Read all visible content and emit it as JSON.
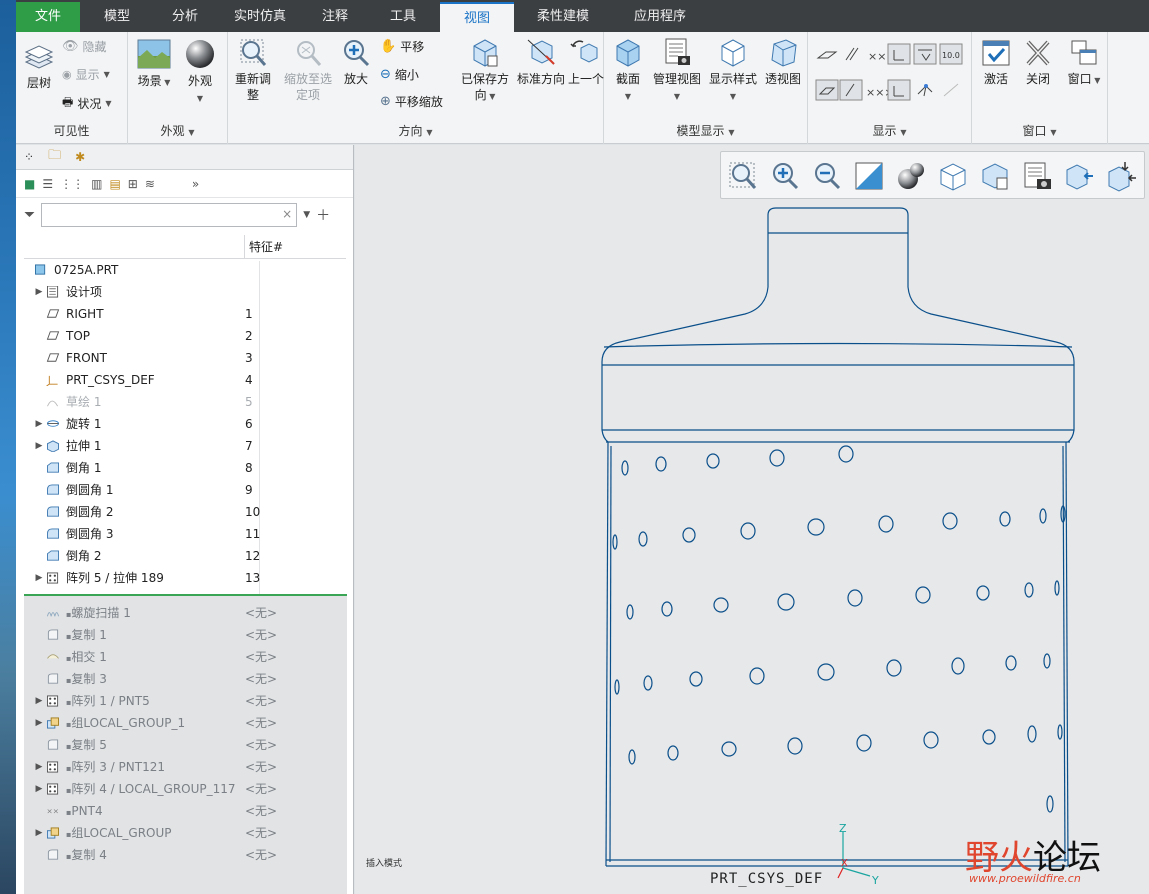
{
  "tabs": [
    {
      "label": "文件",
      "kind": "file"
    },
    {
      "label": "模型"
    },
    {
      "label": "分析"
    },
    {
      "label": "实时仿真"
    },
    {
      "label": "注释"
    },
    {
      "label": "工具"
    },
    {
      "label": "视图",
      "kind": "active"
    },
    {
      "label": "柔性建模"
    },
    {
      "label": "应用程序"
    }
  ],
  "ribbon": {
    "visibility": {
      "label": "可见性",
      "layer_tree": "层树",
      "hide": "隐藏",
      "show": "显示",
      "status": "状况"
    },
    "appearance": {
      "label": "外观",
      "scene": "场景",
      "appearance": "外观"
    },
    "orientation": {
      "label": "方向",
      "refit_1": "重新调",
      "refit_2": "整",
      "zoom_sel_1": "缩放至选",
      "zoom_sel_2": "定项",
      "zoom_in": "放大",
      "pan": "平移",
      "zoom_out": "缩小",
      "pan_zoom": "平移缩放",
      "saved_1": "已保存方",
      "saved_2": "向",
      "std_orient": "标准方向",
      "previous": "上一个"
    },
    "model_display": {
      "label": "模型显示",
      "section": "截面",
      "manage_views": "管理视图",
      "display_style": "显示样式",
      "perspective": "透视图"
    },
    "display": {
      "label": "显示"
    },
    "window": {
      "label": "窗口",
      "activate": "激活",
      "close": "关闭",
      "windows": "窗口"
    }
  },
  "model_tree": {
    "filter_placeholder": "",
    "column_feature": "特征#",
    "rows": [
      {
        "label": "0725A.PRT",
        "num": "",
        "icon": "part",
        "indent": 0,
        "exp": false
      },
      {
        "label": "设计项",
        "num": "",
        "icon": "design-items",
        "indent": 1,
        "exp": true
      },
      {
        "label": "RIGHT",
        "num": "1",
        "icon": "datum-plane",
        "indent": 1,
        "exp": false
      },
      {
        "label": "TOP",
        "num": "2",
        "icon": "datum-plane",
        "indent": 1,
        "exp": false
      },
      {
        "label": "FRONT",
        "num": "3",
        "icon": "datum-plane",
        "indent": 1,
        "exp": false
      },
      {
        "label": "PRT_CSYS_DEF",
        "num": "4",
        "icon": "csys",
        "indent": 1,
        "exp": false
      },
      {
        "label": "草绘 1",
        "num": "5",
        "icon": "sketch",
        "indent": 1,
        "exp": false,
        "dim": true
      },
      {
        "label": "旋转 1",
        "num": "6",
        "icon": "revolve",
        "indent": 1,
        "exp": true
      },
      {
        "label": "拉伸 1",
        "num": "7",
        "icon": "extrude",
        "indent": 1,
        "exp": true
      },
      {
        "label": "倒角 1",
        "num": "8",
        "icon": "chamfer",
        "indent": 1,
        "exp": false
      },
      {
        "label": "倒圆角 1",
        "num": "9",
        "icon": "round",
        "indent": 1,
        "exp": false
      },
      {
        "label": "倒圆角 2",
        "num": "10",
        "icon": "round",
        "indent": 1,
        "exp": false
      },
      {
        "label": "倒圆角 3",
        "num": "11",
        "icon": "round",
        "indent": 1,
        "exp": false
      },
      {
        "label": "倒角 2",
        "num": "12",
        "icon": "chamfer",
        "indent": 1,
        "exp": false
      },
      {
        "label": "阵列 5 / 拉伸 189",
        "num": "13",
        "icon": "pattern",
        "indent": 1,
        "exp": true
      }
    ],
    "inactive_rows": [
      {
        "label": "螺旋扫描 1",
        "num": "<无>",
        "icon": "helical-sweep",
        "exp": false
      },
      {
        "label": "复制 1",
        "num": "<无>",
        "icon": "copy",
        "exp": false
      },
      {
        "label": "相交 1",
        "num": "<无>",
        "icon": "intersect",
        "exp": false
      },
      {
        "label": "复制 3",
        "num": "<无>",
        "icon": "copy",
        "exp": false
      },
      {
        "label": "阵列 1 / PNT5",
        "num": "<无>",
        "icon": "pattern",
        "exp": true
      },
      {
        "label": "组LOCAL_GROUP_1",
        "num": "<无>",
        "icon": "group",
        "exp": true
      },
      {
        "label": "复制 5",
        "num": "<无>",
        "icon": "copy",
        "exp": false
      },
      {
        "label": "阵列 3 / PNT121",
        "num": "<无>",
        "icon": "pattern",
        "exp": true
      },
      {
        "label": "阵列 4 / LOCAL_GROUP_117",
        "num": "<无>",
        "icon": "pattern",
        "exp": true
      },
      {
        "label": "PNT4",
        "num": "<无>",
        "icon": "datum-point",
        "exp": false
      },
      {
        "label": "组LOCAL_GROUP",
        "num": "<无>",
        "icon": "group",
        "exp": true
      },
      {
        "label": "复制 4",
        "num": "<无>",
        "icon": "copy",
        "exp": false
      }
    ]
  },
  "graphics": {
    "insert_mode": "插入模式",
    "csys_label": "PRT_CSYS_DEF",
    "axis_z": "Z",
    "axis_x": "X",
    "axis_y": "Y"
  },
  "watermark": {
    "text_red": "野火",
    "text_black": "论坛",
    "url": "www.proewildfire.cn"
  },
  "colors": {
    "accent": "#1a73c6",
    "file_tab": "#2f9c47",
    "model_edge": "#0b4f8a"
  }
}
